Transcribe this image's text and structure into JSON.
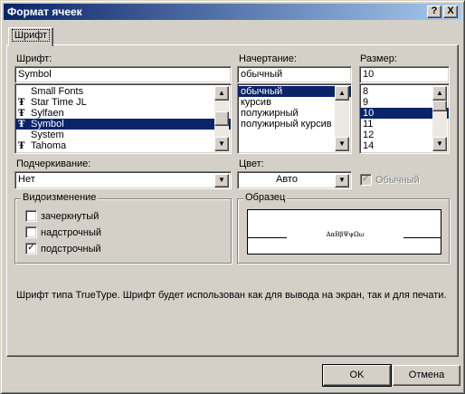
{
  "window": {
    "title": "Формат ячеек",
    "help_label": "?",
    "close_label": "X"
  },
  "tab": {
    "label": "Шрифт"
  },
  "font": {
    "label": "Шрифт:",
    "value": "Symbol",
    "items": [
      {
        "label": "Small Fonts",
        "icon": ""
      },
      {
        "label": "Star Time JL",
        "icon": "truetype-icon"
      },
      {
        "label": "Sylfaen",
        "icon": "truetype-icon"
      },
      {
        "label": "Symbol",
        "icon": "truetype-icon",
        "selected": true
      },
      {
        "label": "System",
        "icon": ""
      },
      {
        "label": "Tahoma",
        "icon": "truetype-icon"
      }
    ]
  },
  "style": {
    "label": "Начертание:",
    "value": "обычный",
    "items": [
      {
        "label": "обычный",
        "selected": true
      },
      {
        "label": "курсив"
      },
      {
        "label": "полужирный"
      },
      {
        "label": "полужирный курсив"
      }
    ]
  },
  "size": {
    "label": "Размер:",
    "value": "10",
    "items": [
      {
        "label": "8"
      },
      {
        "label": "9"
      },
      {
        "label": "10",
        "selected": true
      },
      {
        "label": "11"
      },
      {
        "label": "12"
      },
      {
        "label": "14"
      }
    ]
  },
  "underline": {
    "label": "Подчеркивание:",
    "value": "Нет"
  },
  "color": {
    "label": "Цвет:",
    "value": "Авто",
    "normal_label": "Обычный",
    "normal_checked": true
  },
  "effects": {
    "legend": "Видоизменение",
    "strikethrough": {
      "label": "зачеркнутый",
      "checked": false
    },
    "superscript": {
      "label": "надстрочный",
      "checked": false
    },
    "subscript": {
      "label": "подстрочный",
      "checked": true
    }
  },
  "preview": {
    "legend": "Образец",
    "sample": "ΑαΒβΨψΩω"
  },
  "info_text": "Шрифт типа TrueType. Шрифт будет использован как для вывода на экран, так и для печати.",
  "buttons": {
    "ok": "OK",
    "cancel": "Отмена"
  },
  "colors": {
    "selection": "#0a246a",
    "face": "#d4d0c8"
  }
}
